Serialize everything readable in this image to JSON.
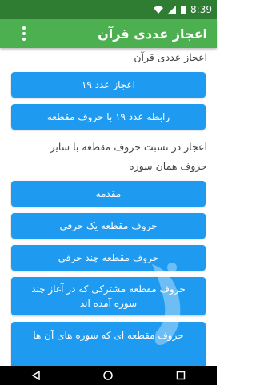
{
  "status_bar": {
    "time": "8:39",
    "icons": [
      "wifi-icon",
      "signal-icon",
      "battery-icon"
    ]
  },
  "app_bar": {
    "title": "اعجاز عددی قرآن",
    "menu_icon": "overflow-menu-icon"
  },
  "sections": [
    {
      "title": "اعجاز عددی قرآن"
    },
    {
      "title_line1": "اعجاز در نسبت حروف مقطعه با سایر",
      "title_line2": "حروف همان سوره"
    }
  ],
  "buttons": [
    {
      "label": "اعجاز عدد ۱۹"
    },
    {
      "label": "رابطه عدد ۱۹ با حروف مقطعه"
    },
    {
      "label": "مقدمه"
    },
    {
      "label": "حروف مقطعه یک حرفی"
    },
    {
      "label": "حروف مقطعه چند حرفی"
    },
    {
      "label": "حروف مقطعه مشترکی که در آغاز چند سوره آمده اند"
    },
    {
      "label": "حروف مقطعه ای که سوره های آن ها"
    }
  ],
  "colors": {
    "status_bar": "#2e7d32",
    "app_bar": "#4caf50",
    "button": "#1e9bf0",
    "nav_bar": "#000000"
  },
  "nav_bar": {
    "icons": [
      "back-icon",
      "home-icon",
      "recents-icon"
    ]
  }
}
